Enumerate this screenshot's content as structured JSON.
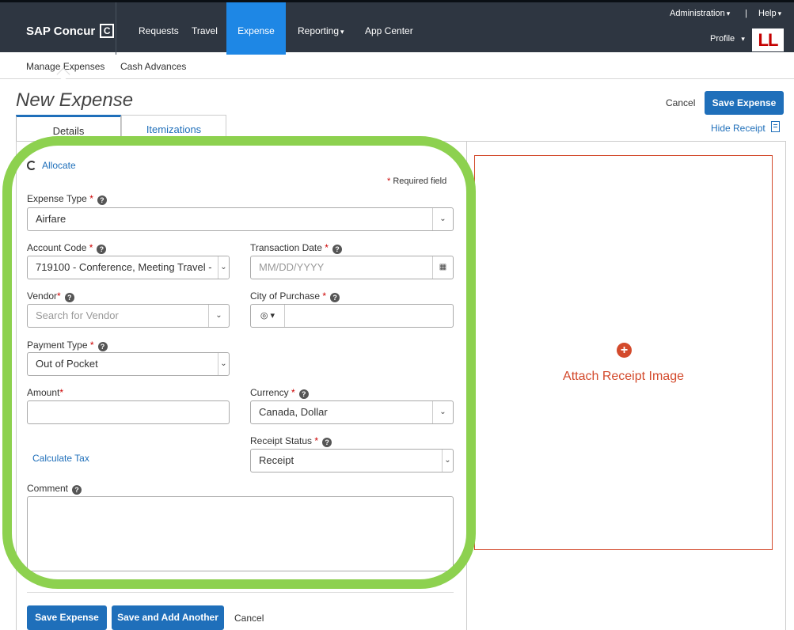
{
  "topnav": {
    "brand": "SAP Concur",
    "brand_mark": "C",
    "items": [
      "Requests",
      "Travel",
      "Expense",
      "Reporting",
      "App Center"
    ],
    "active": "Expense",
    "administration": "Administration",
    "help": "Help",
    "separator": "|",
    "profile": "Profile",
    "avatar_initials": "LL"
  },
  "subnav": {
    "items": [
      "Manage Expenses",
      "Cash Advances"
    ]
  },
  "header": {
    "title": "New Expense",
    "cancel": "Cancel",
    "save": "Save Expense"
  },
  "tabs": [
    "Details",
    "Itemizations"
  ],
  "receipt_toggle": "Hide Receipt",
  "form": {
    "allocate": "Allocate",
    "required_note": "Required field",
    "expense_type": {
      "label": "Expense Type",
      "value": "Airfare"
    },
    "account_code": {
      "label": "Account Code",
      "value": "719100 - Conference, Meeting Travel -"
    },
    "transaction_date": {
      "label": "Transaction Date",
      "placeholder": "MM/DD/YYYY"
    },
    "vendor": {
      "label": "Vendor",
      "placeholder": "Search for Vendor"
    },
    "city": {
      "label": "City of Purchase",
      "value": ""
    },
    "payment_type": {
      "label": "Payment Type",
      "value": "Out of Pocket"
    },
    "amount": {
      "label": "Amount",
      "value": ""
    },
    "currency": {
      "label": "Currency",
      "value": "Canada, Dollar"
    },
    "receipt_status": {
      "label": "Receipt Status",
      "value": "Receipt"
    },
    "calculate_tax": "Calculate Tax",
    "comment": {
      "label": "Comment",
      "value": ""
    }
  },
  "footer": {
    "save": "Save Expense",
    "save_add": "Save and Add Another",
    "cancel": "Cancel"
  },
  "receipt": {
    "attach": "Attach Receipt Image"
  },
  "colors": {
    "nav_bg": "#2e3641",
    "accent": "#1f6fba",
    "receipt_red": "#d34a2c",
    "highlight_green": "#8dd14f"
  }
}
